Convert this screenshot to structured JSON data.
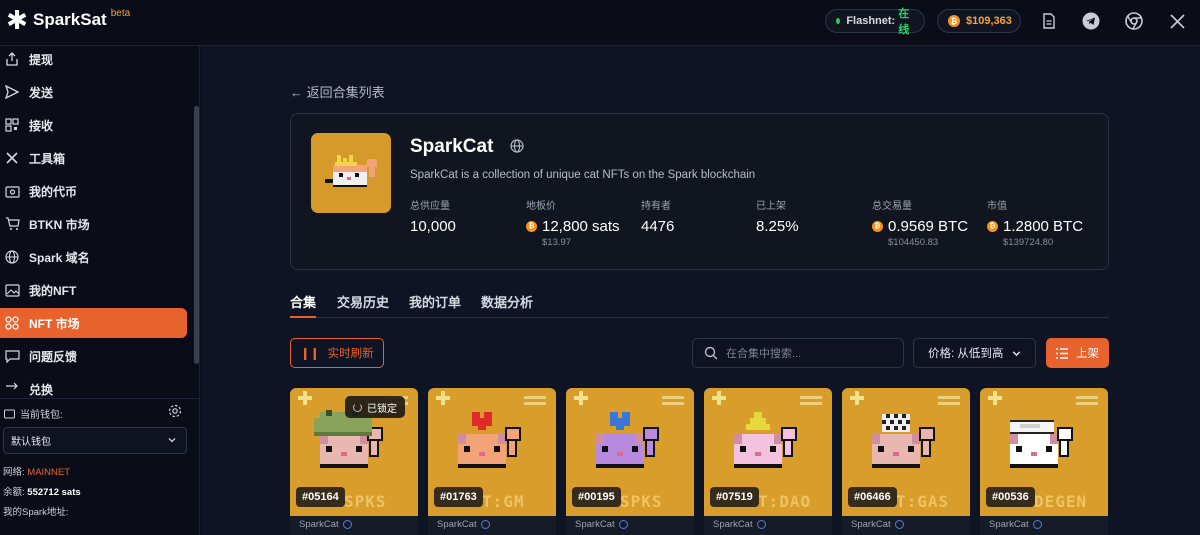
{
  "brand": {
    "name": "SparkSat",
    "beta": "beta"
  },
  "topbar": {
    "network_label": "Flashnet:",
    "network_status": "在线",
    "btc_price": "$109,363",
    "icons": [
      "document-icon",
      "telegram-icon",
      "chrome-icon",
      "x-icon"
    ]
  },
  "sidebar": {
    "items": [
      {
        "label": "提现",
        "icon": "upload-icon"
      },
      {
        "label": "发送",
        "icon": "send-icon"
      },
      {
        "label": "接收",
        "icon": "qr-code-icon"
      },
      {
        "label": "工具箱",
        "icon": "tools-icon"
      },
      {
        "label": "我的代币",
        "icon": "wallet-icon"
      },
      {
        "label": "BTKN 市场",
        "icon": "cart-icon"
      },
      {
        "label": "Spark 域名",
        "icon": "globe-icon"
      },
      {
        "label": "我的NFT",
        "icon": "image-icon"
      },
      {
        "label": "NFT 市场",
        "icon": "grid-icon",
        "active": true
      },
      {
        "label": "问题反馈",
        "icon": "chat-icon"
      },
      {
        "label": "兑换",
        "icon": "swap-icon"
      }
    ],
    "wallet_label": "当前钱包:",
    "wallet_selected": "默认钱包",
    "network_label": "网络:",
    "network_value": "MAINNET",
    "balance_label": "余额:",
    "balance_value": "552712 sats",
    "address_label": "我的Spark地址:"
  },
  "main": {
    "back_link": "← 返回合集列表",
    "collection": {
      "title": "SparkCat",
      "description": "SparkCat is a collection of unique cat NFTs on the Spark blockchain",
      "stats": [
        {
          "label": "总供应量",
          "value": "10,000",
          "sub": "",
          "btc": false
        },
        {
          "label": "地板价",
          "value": "12,800 sats",
          "sub": "$13.97",
          "btc": true
        },
        {
          "label": "持有者",
          "value": "4476",
          "sub": "",
          "btc": false
        },
        {
          "label": "已上架",
          "value": "8.25%",
          "sub": "",
          "btc": false
        },
        {
          "label": "总交易量",
          "value": "0.9569 BTC",
          "sub": "$104450.83",
          "btc": true
        },
        {
          "label": "市值",
          "value": "1.2800 BTC",
          "sub": "$139724.80",
          "btc": true
        }
      ]
    },
    "tabs": [
      "合集",
      "交易历史",
      "我的订单",
      "数据分析"
    ],
    "refresh_label": "实时刷新",
    "search_placeholder": "在合集中搜索...",
    "sort_label": "价格: 从低到高",
    "list_button": "上架",
    "locked_label": "已锁定",
    "nfts": [
      {
        "id": "#05164",
        "name": "SparkCat",
        "hat": "frog",
        "fur": "#e8b7b0",
        "locked": true,
        "text": "SPKS"
      },
      {
        "id": "#01763",
        "name": "SparkCat",
        "hat": "heart-red",
        "fur": "#f2a478",
        "locked": false,
        "text": "T:GM"
      },
      {
        "id": "#00195",
        "name": "SparkCat",
        "hat": "heart-blue",
        "fur": "#b78ae0",
        "locked": false,
        "text": "SPKS"
      },
      {
        "id": "#07519",
        "name": "SparkCat",
        "hat": "party",
        "fur": "#f2c2de",
        "locked": false,
        "text": "T:DAO"
      },
      {
        "id": "#06466",
        "name": "SparkCat",
        "hat": "checker",
        "fur": "#e8b7b0",
        "locked": false,
        "text": "T:GAS"
      },
      {
        "id": "#00536",
        "name": "SparkCat",
        "hat": "cap",
        "fur": "#ffffff",
        "locked": false,
        "text": "DEGEN"
      }
    ]
  }
}
